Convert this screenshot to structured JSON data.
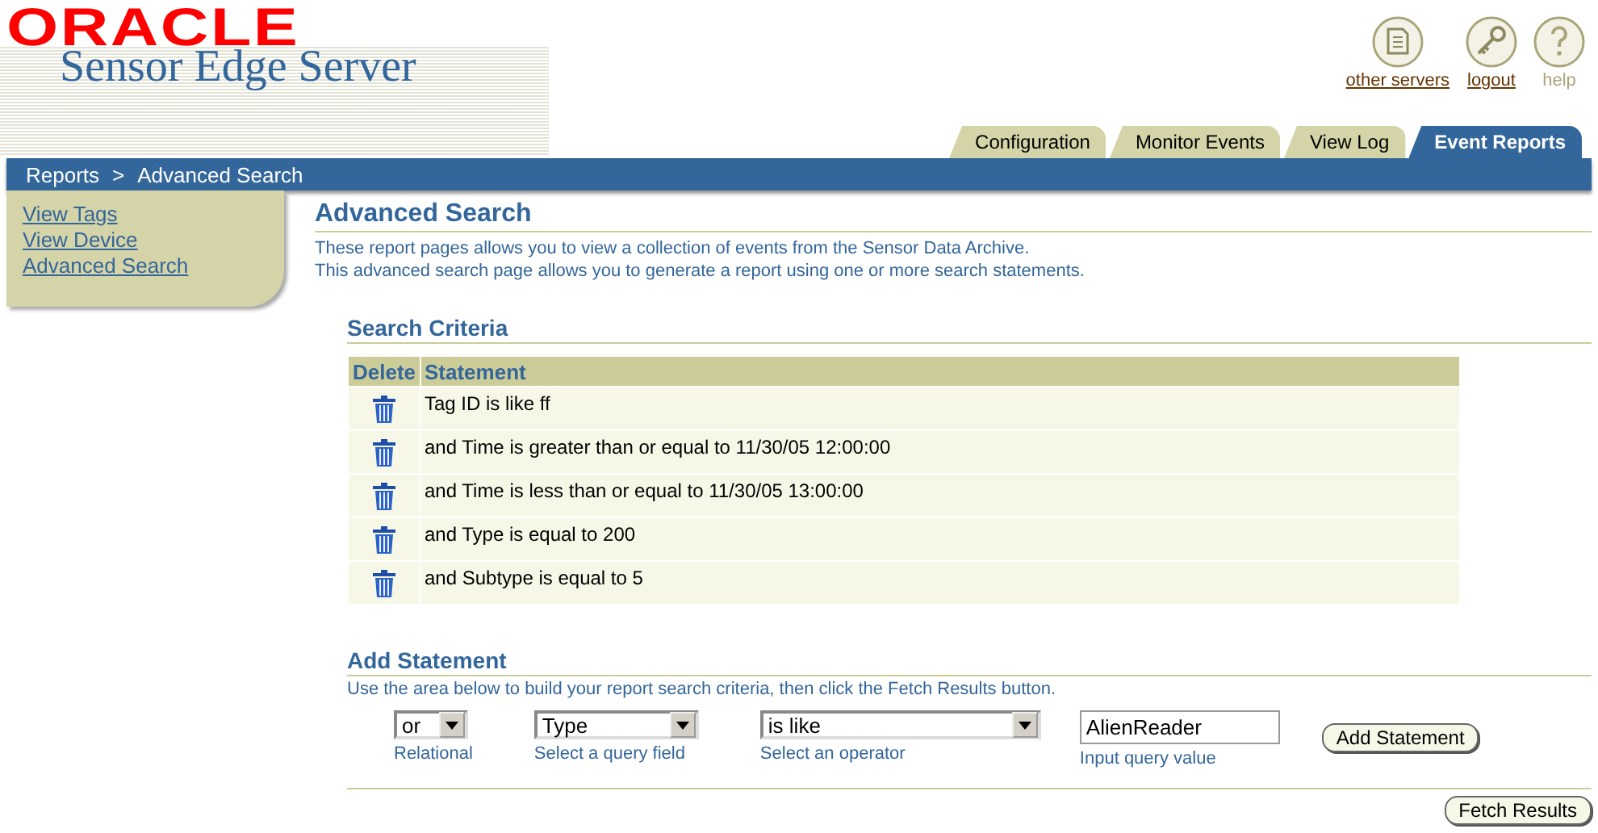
{
  "header": {
    "logo": "ORACLE",
    "product": "Sensor Edge Server"
  },
  "global_links": [
    {
      "label": "other servers",
      "disabled": false
    },
    {
      "label": "logout",
      "disabled": false
    },
    {
      "label": "help",
      "disabled": true
    }
  ],
  "tabs": [
    {
      "label": "Configuration",
      "selected": false
    },
    {
      "label": "Monitor Events",
      "selected": false
    },
    {
      "label": "View Log",
      "selected": false
    },
    {
      "label": "Event Reports",
      "selected": true
    }
  ],
  "breadcrumb": [
    "Reports",
    ">",
    "Advanced Search"
  ],
  "sidebar": {
    "items": [
      "View Tags",
      "View Device",
      "Advanced Search"
    ]
  },
  "page": {
    "title": "Advanced Search",
    "description": [
      "These report pages allows you to view a collection of events from the Sensor Data Archive.",
      "This advanced search page allows you to generate a report using one or more search statements."
    ]
  },
  "search_criteria": {
    "title": "Search Criteria",
    "columns": [
      "Delete",
      "Statement"
    ],
    "rows": [
      {
        "statement": "Tag ID is like ff"
      },
      {
        "statement": "and Time is greater than or equal to 11/30/05 12:00:00"
      },
      {
        "statement": "and Time is less than or equal to 11/30/05 13:00:00"
      },
      {
        "statement": "and Type is equal to 200"
      },
      {
        "statement": "and Subtype is equal to 5"
      }
    ]
  },
  "add_statement": {
    "title": "Add Statement",
    "instructions": "Use the area below to build your report search criteria, then click the Fetch Results button.",
    "fields": [
      {
        "kind": "select",
        "value": "or",
        "label": "Relational"
      },
      {
        "kind": "select",
        "value": "Type",
        "label": "Select a query field"
      },
      {
        "kind": "select",
        "value": "is like",
        "label": "Select an operator"
      },
      {
        "kind": "input",
        "value": "AlienReader",
        "label": "Input query value"
      }
    ],
    "button": "Add Statement"
  },
  "fetch_button": "Fetch Results"
}
